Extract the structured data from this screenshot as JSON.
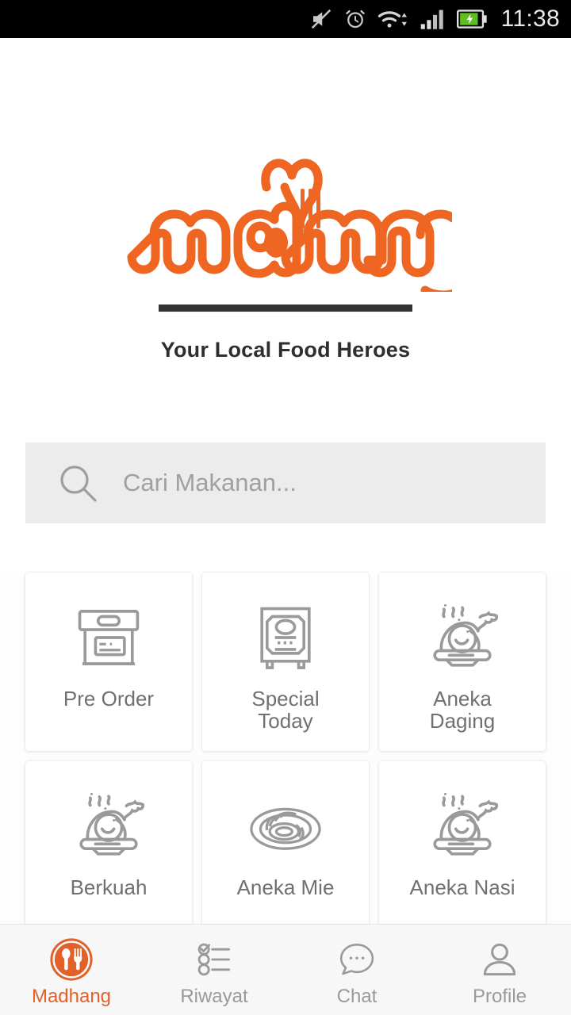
{
  "statusbar": {
    "time": "11:38",
    "icons": [
      "mute-icon",
      "alarm-icon",
      "wifi-icon",
      "signal-icon",
      "battery-charging-icon"
    ]
  },
  "header": {
    "logo_text": "madhang",
    "tagline": "Your Local Food Heroes",
    "brand_color": "#EE6622",
    "divider_color": "#333333"
  },
  "search": {
    "placeholder": "Cari Makanan...",
    "value": "",
    "icon": "search-icon",
    "background": "#ECECEC"
  },
  "categories": [
    {
      "label": "Pre Order",
      "icon": "package-box-icon"
    },
    {
      "label": "Special\nToday",
      "icon": "menu-board-icon"
    },
    {
      "label": "Aneka\nDaging",
      "icon": "roast-chicken-icon"
    },
    {
      "label": "Berkuah",
      "icon": "roast-chicken-icon"
    },
    {
      "label": "Aneka Mie",
      "icon": "noodles-icon"
    },
    {
      "label": "Aneka Nasi",
      "icon": "roast-chicken-icon"
    }
  ],
  "bottomnav": {
    "active_color": "#E2612A",
    "inactive_color": "#9A9A9A",
    "items": [
      {
        "label": "Madhang",
        "icon": "spoon-fork-circle-icon",
        "active": true
      },
      {
        "label": "Riwayat",
        "icon": "checklist-icon",
        "active": false
      },
      {
        "label": "Chat",
        "icon": "chat-bubble-icon",
        "active": false
      },
      {
        "label": "Profile",
        "icon": "person-icon",
        "active": false
      }
    ]
  }
}
